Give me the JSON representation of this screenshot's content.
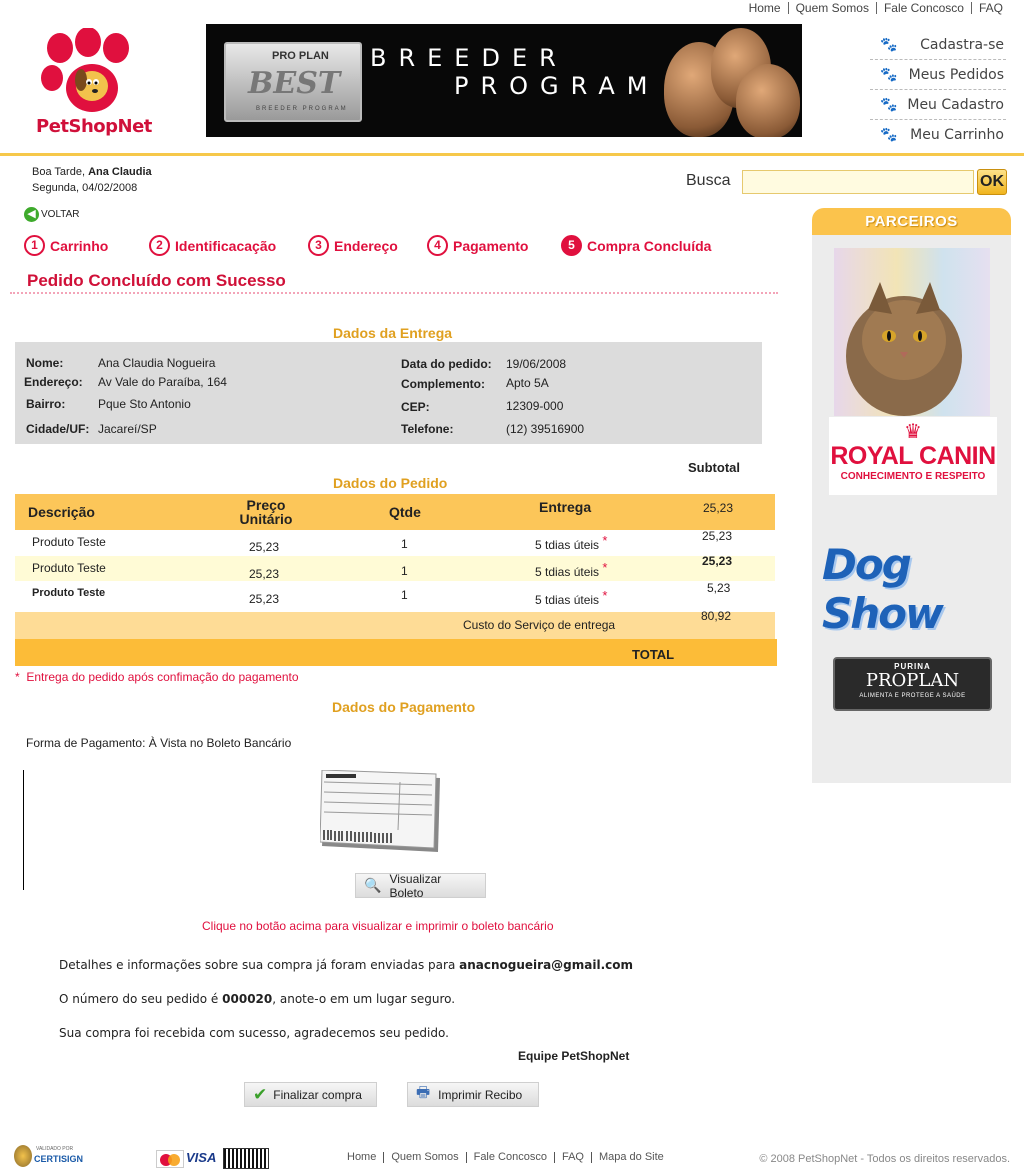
{
  "top_nav": [
    "Home",
    "Quem Somos",
    "Fale Concosco",
    "FAQ"
  ],
  "logo_text": "PetShopNet",
  "banner": {
    "brand_top": "PRO PLAN",
    "brand_main": "BEST",
    "brand_sub": "BREEDER PROGRAM",
    "line1": "BREEDER",
    "line2": "PROGRAM"
  },
  "user_nav": [
    "Cadastra-se",
    "Meus Pedidos",
    "Meu Cadastro",
    "Meu Carrinho"
  ],
  "greeting": {
    "prefix": "Boa Tarde,",
    "name": "Ana Claudia",
    "date": "Segunda, 04/02/2008"
  },
  "search": {
    "label": "Busca",
    "button": "OK",
    "value": ""
  },
  "back_label": "VOLTAR",
  "steps": [
    {
      "num": "1",
      "label": "Carrinho",
      "active": false
    },
    {
      "num": "2",
      "label": "Identificacação",
      "active": false
    },
    {
      "num": "3",
      "label": "Endereço",
      "active": false
    },
    {
      "num": "4",
      "label": "Pagamento",
      "active": false
    },
    {
      "num": "5",
      "label": "Compra Concluída",
      "active": true
    }
  ],
  "page_title": "Pedido Concluído com Sucesso",
  "delivery": {
    "title": "Dados da Entrega",
    "nome_label": "Nome:",
    "nome": "Ana Claudia Nogueira",
    "endereco_label": "Endereço:",
    "endereco": "Av Vale do Paraíba, 164",
    "bairro_label": "Bairro:",
    "bairro": "Pque Sto Antonio",
    "cidade_label": "Cidade/UF:",
    "cidade": "Jacareí/SP",
    "data_label": "Data do pedido:",
    "data": "19/06/2008",
    "complemento_label": "Complemento:",
    "complemento": "Apto 5A",
    "cep_label": "CEP:",
    "cep": "12309-000",
    "telefone_label": "Telefone:",
    "telefone": "(12) 39516900"
  },
  "order": {
    "title": "Dados do Pedido",
    "subtotal_label": "Subtotal",
    "headers": {
      "descricao": "Descrição",
      "preco": "Preço Unitário",
      "qtde": "Qtde",
      "entrega": "Entrega"
    },
    "header_subtotal": "25,23",
    "rows": [
      {
        "desc": "Produto Teste",
        "preco": "25,23",
        "qtde": "1",
        "entrega": "5 tdias úteis",
        "subtotal": "25,23"
      },
      {
        "desc": "Produto Teste",
        "preco": "25,23",
        "qtde": "1",
        "entrega": "5 tdias úteis",
        "subtotal": "25,23"
      },
      {
        "desc": "Produto Teste",
        "preco": "25,23",
        "qtde": "1",
        "entrega": "5 tdias úteis",
        "subtotal": "5,23"
      }
    ],
    "shipping_label": "Custo do Serviço de entrega",
    "shipping_value": "80,92",
    "total_label": "TOTAL",
    "note": "Entrega do pedido após confimação do pagamento"
  },
  "payment": {
    "title": "Dados do Pagamento",
    "method": "Forma de Pagamento: À Vista no Boleto Bancário",
    "view_button": "Visualizar Boleto",
    "instruction": "Clique no botão acima para visualizar e imprimir o boleto bancário"
  },
  "messages": {
    "details_prefix": "Detalhes e informações sobre sua compra já foram enviadas para",
    "email": "anacnogueira@gmail.com",
    "order_prefix": "O número do seu pedido é",
    "order_number": "000020",
    "order_suffix": ", anote-o em um lugar seguro.",
    "thanks": "Sua compra foi recebida com sucesso, agradecemos seu pedido.",
    "team": "Equipe PetShopNet"
  },
  "actions": {
    "finish": "Finalizar compra",
    "print": "Imprimir Recibo"
  },
  "sidebar": {
    "title": "PARCEIROS",
    "royal_canin": "ROYAL CANIN",
    "royal_canin_tag": "CONHECIMENTO E RESPEITO",
    "dog_show": "Dog Show",
    "purina": "PURINA",
    "proplan": "PROPLAN",
    "proplan_tag": "ALIMENTA E PROTEGE A SAÚDE"
  },
  "footer": {
    "certisign_top": "VALIDADO POR",
    "certisign": "CERTISIGN",
    "links": [
      "Home",
      "Quem Somos",
      "Fale Concosco",
      "FAQ",
      "Mapa do Site"
    ],
    "copyright": "© 2008 PetShopNet - Todos os direitos reservados."
  },
  "colors": {
    "accent_red": "#e0103e",
    "gold": "#fcc659",
    "section_title": "#e0a020"
  }
}
